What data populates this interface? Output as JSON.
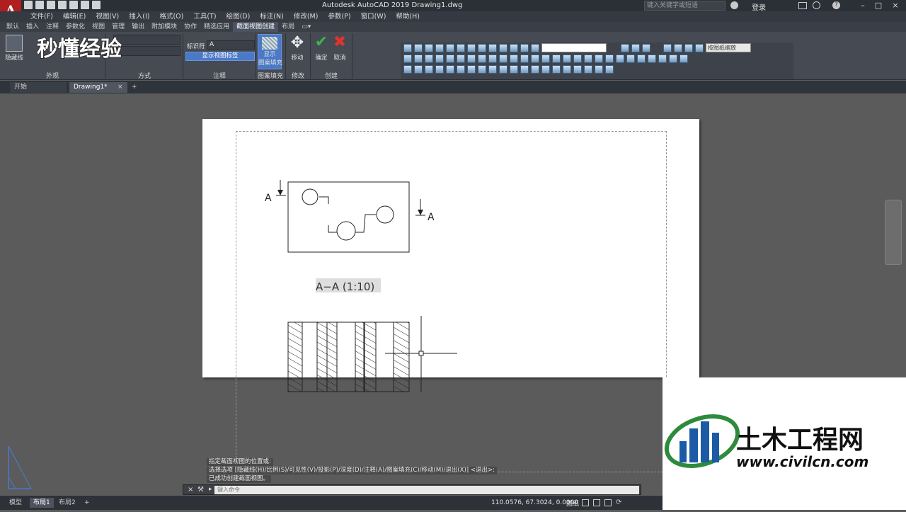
{
  "app": {
    "logo_letter": "A",
    "title": "Autodesk AutoCAD 2019    Drawing1.dwg",
    "search_placeholder": "键入关键字或短语",
    "login": "登录"
  },
  "menu": [
    "文件(F)",
    "编辑(E)",
    "视图(V)",
    "插入(I)",
    "格式(O)",
    "工具(T)",
    "绘图(D)",
    "标注(N)",
    "修改(M)",
    "参数(P)",
    "窗口(W)",
    "帮助(H)"
  ],
  "ribbon_tabs": [
    "默认",
    "插入",
    "注释",
    "参数化",
    "视图",
    "管理",
    "输出",
    "附加模块",
    "协作",
    "精选应用",
    "截面视图创建",
    "布局"
  ],
  "ribbon_active_tab": "截面视图创建",
  "ribbon": {
    "hidden_line_label": "隐藏线",
    "panel_appearance": "外观",
    "panel_method": "方式",
    "identifier_label": "标识符",
    "identifier_value": "A",
    "show_view_label": "显示视图标签",
    "panel_annotation": "注释",
    "show_hatch_label": "显示",
    "show_hatch_label2": "图案填充",
    "panel_hatch": "图案填充",
    "move_label": "移动",
    "panel_modify": "修改",
    "ok_label": "确定",
    "cancel_label": "取消",
    "panel_create": "创建",
    "viewport_scale": "按图纸缩放"
  },
  "doc_tabs": {
    "start": "开始",
    "drawing": "Drawing1*",
    "add": "+"
  },
  "drawing": {
    "section_marker_left": "A",
    "section_marker_right": "A",
    "section_label": "A−A  (1:10)"
  },
  "command": {
    "line1": "指定截面视图的位置或:",
    "line2": "选择选项 [隐藏线(H)/比例(S)/可见性(V)/投影(P)/深度(D)/注释(A)/图案填充(C)/移动(M)/退出(X)] <退出>:",
    "line3": "已成功创建截面视图。",
    "input_placeholder": "键入命令"
  },
  "status": {
    "tabs": [
      "模型",
      "布局1",
      "布局2"
    ],
    "active_tab": "布局1",
    "coords": "110.0576, 67.3024, 0.0000",
    "paper": "图纸"
  },
  "watermarks": {
    "left_brand": "秒懂经验",
    "right_brand": "土木工程网",
    "right_url": "www.civilcn.com"
  },
  "colors": {
    "accent_red": "#b01e1e",
    "ok_green": "#3bb54a",
    "cancel_red": "#e0342f",
    "highlight_blue": "#4a79c7"
  }
}
